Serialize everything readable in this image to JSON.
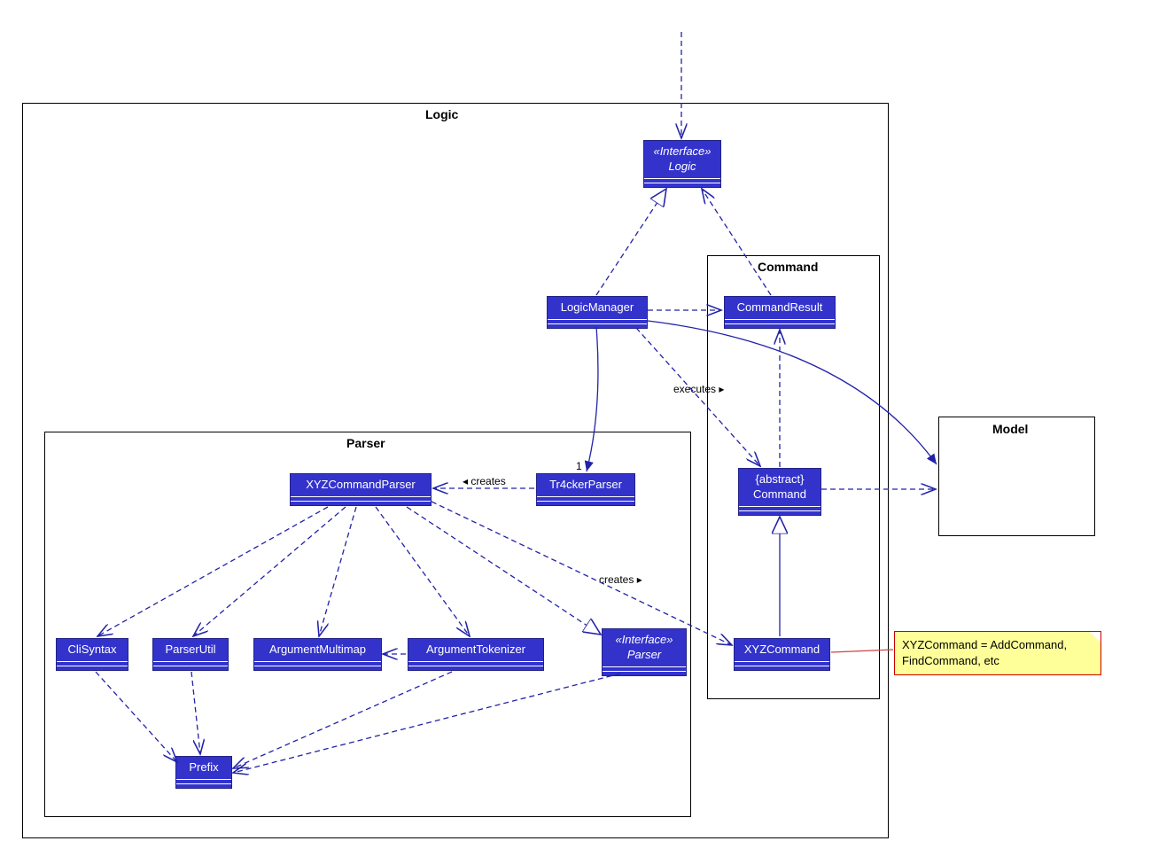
{
  "packages": {
    "logic": {
      "label": "Logic"
    },
    "parser": {
      "label": "Parser"
    },
    "command": {
      "label": "Command"
    },
    "model": {
      "label": "Model"
    }
  },
  "classes": {
    "logicInterface": {
      "stereotype": "«Interface»",
      "name": "Logic"
    },
    "logicManager": {
      "name": "LogicManager"
    },
    "commandResult": {
      "name": "CommandResult"
    },
    "abstractCommand": {
      "stereotype": "{abstract}",
      "name": "Command"
    },
    "xyzCommand": {
      "name": "XYZCommand"
    },
    "xyzCommandParser": {
      "name": "XYZCommandParser"
    },
    "tr4ckerParser": {
      "name": "Tr4ckerParser"
    },
    "parserInterface": {
      "stereotype": "«Interface»",
      "name": "Parser"
    },
    "cliSyntax": {
      "name": "CliSyntax"
    },
    "parserUtil": {
      "name": "ParserUtil"
    },
    "argumentMultimap": {
      "name": "ArgumentMultimap"
    },
    "argumentTokenizer": {
      "name": "ArgumentTokenizer"
    },
    "prefix": {
      "name": "Prefix"
    }
  },
  "edgeLabels": {
    "creates1": "creates",
    "creates2": "creates",
    "executes": "executes",
    "one": "1"
  },
  "note": {
    "text": "XYZCommand = AddCommand, FindCommand, etc"
  }
}
